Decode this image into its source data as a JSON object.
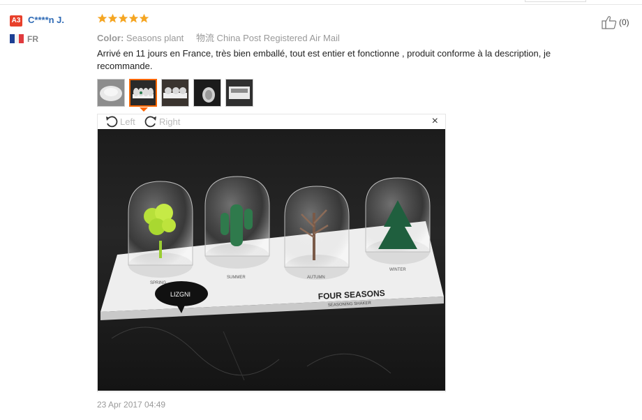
{
  "reviewer": {
    "badge": "A3",
    "name": "C****n J.",
    "country": "FR"
  },
  "rating": {
    "stars": 5,
    "max": 5,
    "color": "#f5a623"
  },
  "meta": {
    "color_label": "Color:",
    "color_value": "Seasons plant",
    "shipping": "物流 China Post Registered Air Mail"
  },
  "review_text": "Arrivé en 11 jours en France, très bien emballé, tout est entier et fonctionne , produit conforme à la description, je recommande.",
  "helpful": {
    "count": "(0)",
    "icon": "thumbs-up-icon"
  },
  "thumbnails": [
    {
      "name": "thumb-1"
    },
    {
      "name": "thumb-2",
      "active": true
    },
    {
      "name": "thumb-3"
    },
    {
      "name": "thumb-4"
    },
    {
      "name": "thumb-5"
    }
  ],
  "viewer": {
    "rotate_left": "Left",
    "rotate_right": "Right",
    "close": "×",
    "photo": {
      "brand_label": "LIZGNI",
      "product_title": "FOUR SEASONS",
      "product_subtitle": "SEASONING SHAKER",
      "season_labels": [
        "SPRING",
        "SUMMER",
        "AUTUMN",
        "WINTER"
      ]
    }
  },
  "date": "23 Apr 2017 04:49",
  "colors": {
    "accent": "#f60",
    "link": "#2e6ab5",
    "badge": "#e8402b"
  }
}
